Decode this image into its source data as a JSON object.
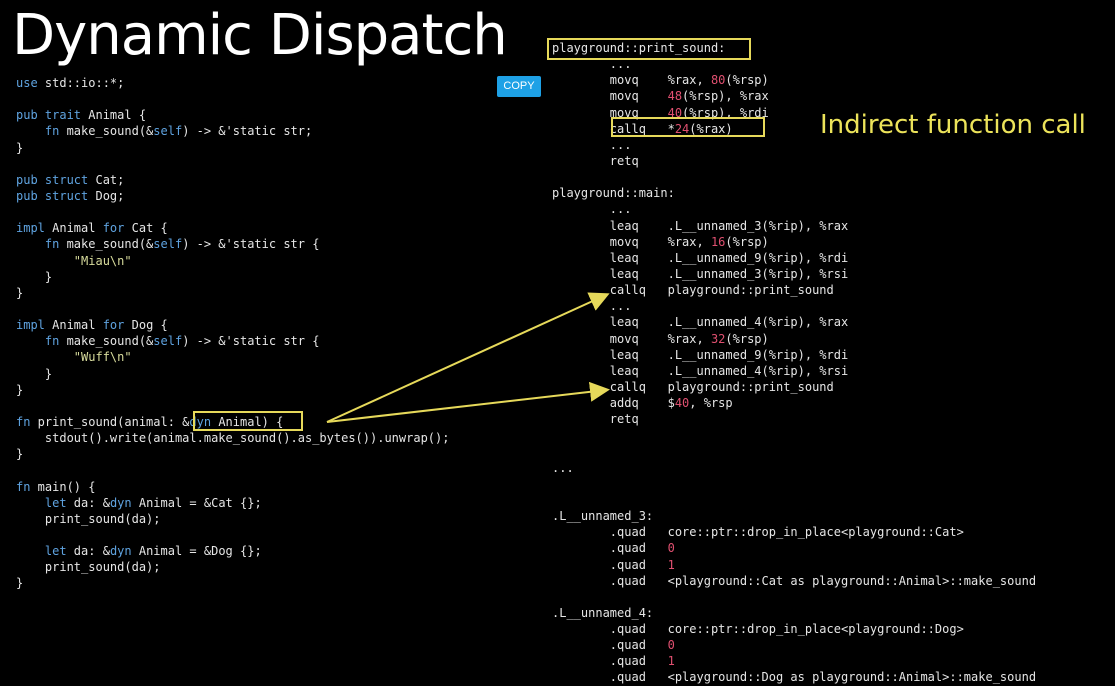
{
  "title": "Dynamic Dispatch",
  "copy_button": "COPY",
  "callout": "Indirect function call",
  "rust_code": [
    [
      {
        "t": "use",
        "c": "kw"
      },
      {
        "t": " std::io::*;",
        "c": "plain"
      }
    ],
    [],
    [
      {
        "t": "pub trait",
        "c": "kw"
      },
      {
        "t": " Animal {",
        "c": "plain"
      }
    ],
    [
      {
        "t": "    fn",
        "c": "kw"
      },
      {
        "t": " make_sound(&",
        "c": "plain"
      },
      {
        "t": "self",
        "c": "kw"
      },
      {
        "t": ") -> &'static str;",
        "c": "plain"
      }
    ],
    [
      {
        "t": "}",
        "c": "plain"
      }
    ],
    [],
    [
      {
        "t": "pub struct",
        "c": "kw"
      },
      {
        "t": " Cat;",
        "c": "plain"
      }
    ],
    [
      {
        "t": "pub struct",
        "c": "kw"
      },
      {
        "t": " Dog;",
        "c": "plain"
      }
    ],
    [],
    [
      {
        "t": "impl",
        "c": "kw"
      },
      {
        "t": " Animal ",
        "c": "plain"
      },
      {
        "t": "for",
        "c": "kw"
      },
      {
        "t": " Cat {",
        "c": "plain"
      }
    ],
    [
      {
        "t": "    fn",
        "c": "kw"
      },
      {
        "t": " make_sound(&",
        "c": "plain"
      },
      {
        "t": "self",
        "c": "kw"
      },
      {
        "t": ") -> &'static str {",
        "c": "plain"
      }
    ],
    [
      {
        "t": "        \"Miau\\n\"",
        "c": "str"
      }
    ],
    [
      {
        "t": "    }",
        "c": "plain"
      }
    ],
    [
      {
        "t": "}",
        "c": "plain"
      }
    ],
    [],
    [
      {
        "t": "impl",
        "c": "kw"
      },
      {
        "t": " Animal ",
        "c": "plain"
      },
      {
        "t": "for",
        "c": "kw"
      },
      {
        "t": " Dog {",
        "c": "plain"
      }
    ],
    [
      {
        "t": "    fn",
        "c": "kw"
      },
      {
        "t": " make_sound(&",
        "c": "plain"
      },
      {
        "t": "self",
        "c": "kw"
      },
      {
        "t": ") -> &'static str {",
        "c": "plain"
      }
    ],
    [
      {
        "t": "        \"Wuff\\n\"",
        "c": "str"
      }
    ],
    [
      {
        "t": "    }",
        "c": "plain"
      }
    ],
    [
      {
        "t": "}",
        "c": "plain"
      }
    ],
    [],
    [
      {
        "t": "fn",
        "c": "kw"
      },
      {
        "t": " print_sound(animal: &",
        "c": "plain"
      },
      {
        "t": "dyn",
        "c": "kw"
      },
      {
        "t": " Animal) {",
        "c": "plain"
      }
    ],
    [
      {
        "t": "    stdout().write(animal.make_sound().as_bytes()).unwrap();",
        "c": "plain"
      }
    ],
    [
      {
        "t": "}",
        "c": "plain"
      }
    ],
    [],
    [
      {
        "t": "fn",
        "c": "kw"
      },
      {
        "t": " main() {",
        "c": "plain"
      }
    ],
    [
      {
        "t": "    let",
        "c": "kw"
      },
      {
        "t": " da: &",
        "c": "plain"
      },
      {
        "t": "dyn",
        "c": "kw"
      },
      {
        "t": " Animal = &Cat {};",
        "c": "plain"
      }
    ],
    [
      {
        "t": "    print_sound(da);",
        "c": "plain"
      }
    ],
    [],
    [
      {
        "t": "    let",
        "c": "kw"
      },
      {
        "t": " da: &",
        "c": "plain"
      },
      {
        "t": "dyn",
        "c": "kw"
      },
      {
        "t": " Animal = &Dog {};",
        "c": "plain"
      }
    ],
    [
      {
        "t": "    print_sound(da);",
        "c": "plain"
      }
    ],
    [
      {
        "t": "}",
        "c": "plain"
      }
    ]
  ],
  "asm_code": [
    [
      {
        "t": "playground::print_sound:",
        "c": "plain"
      }
    ],
    [
      {
        "t": "        ...",
        "c": "plain"
      }
    ],
    [
      {
        "t": "        movq    %rax, ",
        "c": "plain"
      },
      {
        "t": "80",
        "c": "num"
      },
      {
        "t": "(%rsp)",
        "c": "plain"
      }
    ],
    [
      {
        "t": "        movq    ",
        "c": "plain"
      },
      {
        "t": "48",
        "c": "num"
      },
      {
        "t": "(%rsp), %rax",
        "c": "plain"
      }
    ],
    [
      {
        "t": "        movq    ",
        "c": "plain"
      },
      {
        "t": "40",
        "c": "num"
      },
      {
        "t": "(%rsp), %rdi",
        "c": "plain"
      }
    ],
    [
      {
        "t": "        callq   *",
        "c": "plain"
      },
      {
        "t": "24",
        "c": "num"
      },
      {
        "t": "(%rax)",
        "c": "plain"
      }
    ],
    [
      {
        "t": "        ...",
        "c": "plain"
      }
    ],
    [
      {
        "t": "        retq",
        "c": "plain"
      }
    ],
    [],
    [
      {
        "t": "playground::main:",
        "c": "plain"
      }
    ],
    [
      {
        "t": "        ...",
        "c": "plain"
      }
    ],
    [
      {
        "t": "        leaq    .L__unnamed_3(%rip), %rax",
        "c": "plain"
      }
    ],
    [
      {
        "t": "        movq    %rax, ",
        "c": "plain"
      },
      {
        "t": "16",
        "c": "num"
      },
      {
        "t": "(%rsp)",
        "c": "plain"
      }
    ],
    [
      {
        "t": "        leaq    .L__unnamed_9(%rip), %rdi",
        "c": "plain"
      }
    ],
    [
      {
        "t": "        leaq    .L__unnamed_3(%rip), %rsi",
        "c": "plain"
      }
    ],
    [
      {
        "t": "        callq   playground::print_sound",
        "c": "plain"
      }
    ],
    [
      {
        "t": "        ...",
        "c": "plain"
      }
    ],
    [
      {
        "t": "        leaq    .L__unnamed_4(%rip), %rax",
        "c": "plain"
      }
    ],
    [
      {
        "t": "        movq    %rax, ",
        "c": "plain"
      },
      {
        "t": "32",
        "c": "num"
      },
      {
        "t": "(%rsp)",
        "c": "plain"
      }
    ],
    [
      {
        "t": "        leaq    .L__unnamed_9(%rip), %rdi",
        "c": "plain"
      }
    ],
    [
      {
        "t": "        leaq    .L__unnamed_4(%rip), %rsi",
        "c": "plain"
      }
    ],
    [
      {
        "t": "        callq   playground::print_sound",
        "c": "plain"
      }
    ],
    [
      {
        "t": "        addq    $",
        "c": "plain"
      },
      {
        "t": "40",
        "c": "num"
      },
      {
        "t": ", %rsp",
        "c": "plain"
      }
    ],
    [
      {
        "t": "        retq",
        "c": "plain"
      }
    ],
    [],
    [],
    [
      {
        "t": "...",
        "c": "plain"
      }
    ],
    [],
    [],
    [
      {
        "t": ".L__unnamed_3:",
        "c": "plain"
      }
    ],
    [
      {
        "t": "        .quad   core::ptr::drop_in_place<playground::Cat>",
        "c": "plain"
      }
    ],
    [
      {
        "t": "        .quad   ",
        "c": "plain"
      },
      {
        "t": "0",
        "c": "num"
      }
    ],
    [
      {
        "t": "        .quad   ",
        "c": "plain"
      },
      {
        "t": "1",
        "c": "num"
      }
    ],
    [
      {
        "t": "        .quad   <playground::Cat as playground::Animal>::make_sound",
        "c": "plain"
      }
    ],
    [],
    [
      {
        "t": ".L__unnamed_4:",
        "c": "plain"
      }
    ],
    [
      {
        "t": "        .quad   core::ptr::drop_in_place<playground::Dog>",
        "c": "plain"
      }
    ],
    [
      {
        "t": "        .quad   ",
        "c": "plain"
      },
      {
        "t": "0",
        "c": "num"
      }
    ],
    [
      {
        "t": "        .quad   ",
        "c": "plain"
      },
      {
        "t": "1",
        "c": "num"
      }
    ],
    [
      {
        "t": "        .quad   <playground::Dog as playground::Animal>::make_sound",
        "c": "plain"
      }
    ]
  ]
}
